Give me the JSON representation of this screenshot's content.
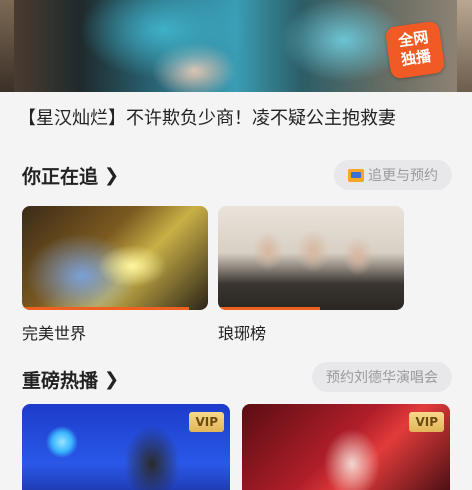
{
  "hero": {
    "badge": "全网\n独播",
    "title": "【星汉灿烂】不许欺负少商！凌不疑公主抱救妻"
  },
  "following": {
    "heading": "你正在追",
    "chevron": "❯",
    "pill_label": "追更与预约",
    "pill_icon": "tv-icon",
    "items": [
      {
        "title": "完美世界",
        "progress": 0.9
      },
      {
        "title": "琅琊榜",
        "progress": 0.55
      }
    ]
  },
  "hot": {
    "heading": "重磅热播",
    "chevron": "❯",
    "pill_label": "预约刘德华演唱会",
    "items": [
      {
        "badge": "VIP"
      },
      {
        "badge": "VIP"
      }
    ]
  },
  "colors": {
    "accent": "#f06020",
    "badge": "#f15a24",
    "vip_gold": "#e2b558"
  }
}
